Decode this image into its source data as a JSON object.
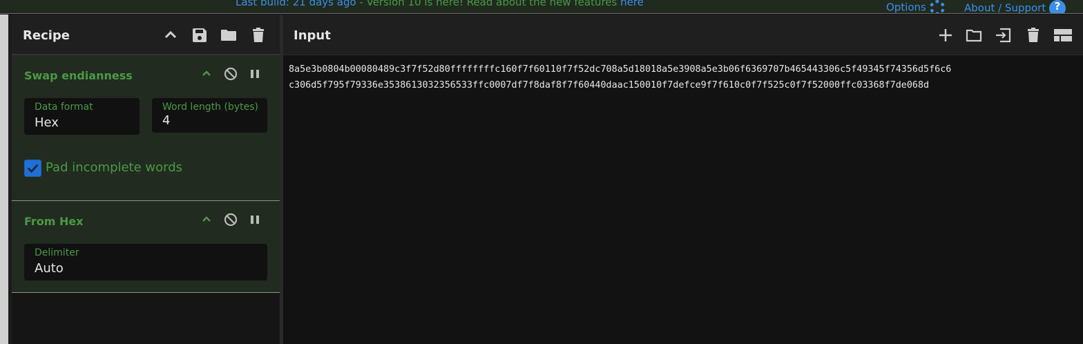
{
  "topbar": {
    "last_build": "Last build: 21 days ago",
    "separator": " - ",
    "version_notice": "Version 10 is here! Read about the new features ",
    "here_link": "here",
    "options": "Options",
    "about": "About / Support"
  },
  "recipe": {
    "title": "Recipe",
    "operations": [
      {
        "name": "Swap endianness",
        "fields": [
          {
            "label": "Data format",
            "value": "Hex"
          },
          {
            "label": "Word length (bytes)",
            "value": "4"
          }
        ],
        "checkbox": {
          "label": "Pad incomplete words",
          "checked": true
        }
      },
      {
        "name": "From Hex",
        "fields": [
          {
            "label": "Delimiter",
            "value": "Auto"
          }
        ]
      }
    ]
  },
  "input": {
    "title": "Input",
    "lines": [
      "8a5e3b0804b00080489c3f7f52d80ffffffffc160f7f60110f7f52dc708a5d18018a5e3908a5e3b06f6369707b465443306c5f49345f74356d5f6c6",
      "c306d5f795f79336e3538613032356533ffc0007df7f8daf8f7f60440daac150010f7defce9f7f610c0f7f525c0f7f52000ffc03368f7de068d"
    ]
  }
}
